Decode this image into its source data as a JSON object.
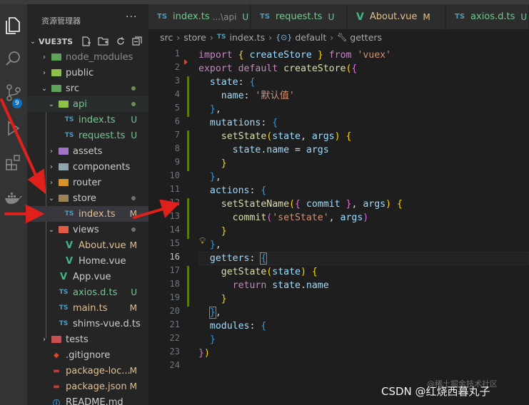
{
  "sidebar": {
    "title": "资源管理器",
    "more_icon": "ellipsis-icon",
    "project": "VUE3TS",
    "toolbar_icons": [
      "new-file-icon",
      "new-folder-icon",
      "refresh-icon",
      "collapse-all-icon"
    ]
  },
  "activity_bar": {
    "icons": [
      "explorer-icon",
      "search-icon",
      "source-control-icon",
      "run-debug-icon",
      "extensions-icon",
      "docker-icon"
    ],
    "scm_badge": "9"
  },
  "tree": [
    {
      "label": "node_modules",
      "status": ""
    },
    {
      "label": "public",
      "status": ""
    },
    {
      "label": "src",
      "status": ""
    },
    {
      "label": "api",
      "status": ""
    },
    {
      "label": "index.ts",
      "status": "U"
    },
    {
      "label": "request.ts",
      "status": "U"
    },
    {
      "label": "assets",
      "status": ""
    },
    {
      "label": "components",
      "status": ""
    },
    {
      "label": "router",
      "status": ""
    },
    {
      "label": "store",
      "status": ""
    },
    {
      "label": "index.ts",
      "status": "M"
    },
    {
      "label": "views",
      "status": ""
    },
    {
      "label": "About.vue",
      "status": "M"
    },
    {
      "label": "Home.vue",
      "status": ""
    },
    {
      "label": "App.vue",
      "status": ""
    },
    {
      "label": "axios.d.ts",
      "status": "U"
    },
    {
      "label": "main.ts",
      "status": "M"
    },
    {
      "label": "shims-vue.d.ts",
      "status": ""
    },
    {
      "label": "tests",
      "status": ""
    },
    {
      "label": ".gitignore",
      "status": ""
    },
    {
      "label": "package-loc...",
      "status": "M"
    },
    {
      "label": "package.json",
      "status": "M"
    },
    {
      "label": "README.md",
      "status": ""
    }
  ],
  "tabs": [
    {
      "icon": "TS",
      "name": "index.ts",
      "desc": "...\\api",
      "status": "U"
    },
    {
      "icon": "TS",
      "name": "request.ts",
      "desc": "",
      "status": "U"
    },
    {
      "icon": "V",
      "name": "About.vue",
      "desc": "",
      "status": "M"
    },
    {
      "icon": "TS",
      "name": "axios.d.ts",
      "desc": "",
      "status": "U"
    }
  ],
  "breadcrumb": {
    "parts": [
      "src",
      "store",
      "index.ts",
      "default",
      "getters"
    ],
    "file_icon": "TS"
  },
  "editor": {
    "current_line": "16",
    "line_numbers": [
      "1",
      "2",
      "3",
      "4",
      "5",
      "6",
      "7",
      "8",
      "9",
      "10",
      "11",
      "12",
      "13",
      "14",
      "15",
      "16",
      "17",
      "18",
      "19",
      "20",
      "21",
      "22",
      "23",
      "24"
    ],
    "lightbulb_icon": "lightbulb-icon"
  },
  "watermark": {
    "text": "CSDN @红烧西暮丸子",
    "faint": "@稀土掘金技术社区"
  },
  "colors": {
    "accent": "#0e70c0",
    "modified": "#e2c08d",
    "untracked": "#73c991",
    "annotation_arrow": "#e0201b"
  }
}
